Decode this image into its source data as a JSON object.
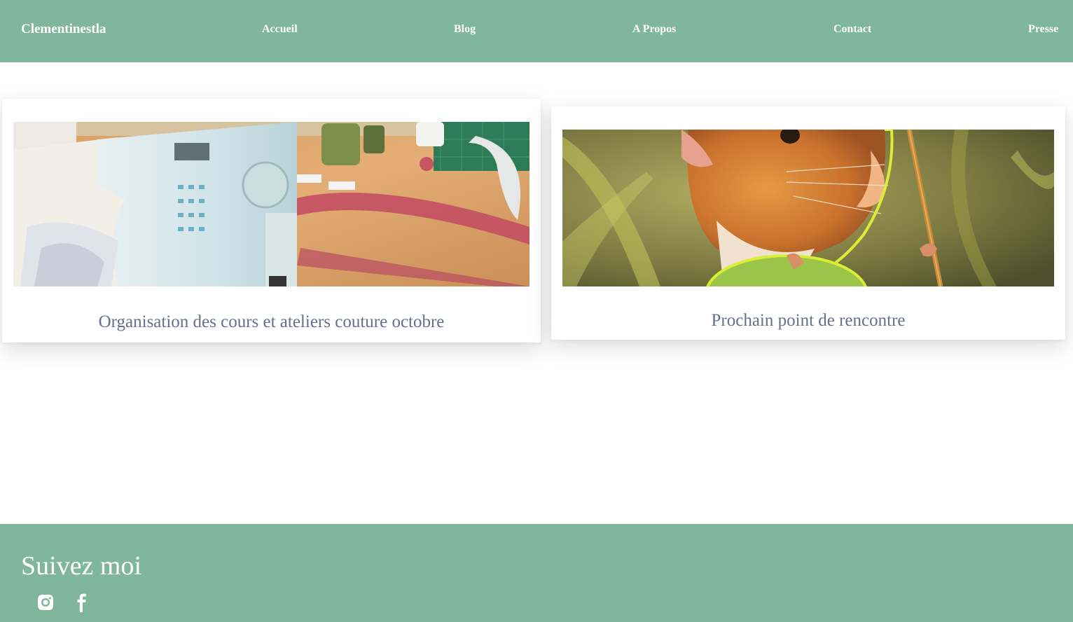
{
  "header": {
    "brand": "Clementinestla",
    "nav": [
      {
        "label": "Accueil"
      },
      {
        "label": "Blog"
      },
      {
        "label": "A Propos"
      },
      {
        "label": "Contact"
      },
      {
        "label": "Presse"
      }
    ]
  },
  "posts": [
    {
      "title": "Organisation des cours et ateliers couture octobre",
      "image_icon": "sewing-machine-photo"
    },
    {
      "title": "Prochain point de rencontre",
      "image_icon": "mouse-illustration"
    }
  ],
  "footer": {
    "title": "Suivez moi",
    "social": [
      {
        "icon": "instagram-icon"
      },
      {
        "icon": "facebook-icon"
      }
    ]
  },
  "colors": {
    "accent": "#7fb69c",
    "post_title": "#666f8e",
    "text_on_accent": "#ffffff"
  }
}
